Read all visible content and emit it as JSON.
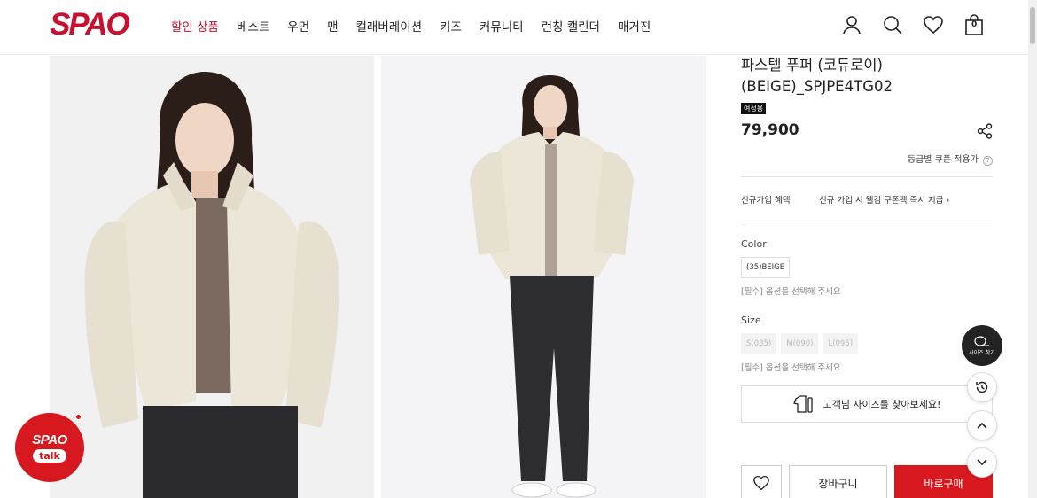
{
  "header": {
    "logo": "SPAO",
    "nav": [
      "할인 상품",
      "베스트",
      "우먼",
      "맨",
      "컬래버레이션",
      "키즈",
      "커뮤니티",
      "런칭 캘린더",
      "매거진"
    ],
    "cart_count": "0"
  },
  "product": {
    "title_line1": "파스텔 푸퍼 (코듀로이)",
    "title_line2": "(BEIGE)_SPJPE4TG02",
    "badge": "여성용",
    "price": "79,900",
    "coupon": "등급별 쿠폰 적용가",
    "coupon_help": "?",
    "benefit_label": "신규가입 혜택",
    "benefit_value": "신규 가입 시 웰컴 쿠폰팩 즉시 지급 ›",
    "color_label": "Color",
    "color_options": [
      "(35)BEIGE"
    ],
    "color_hint": "[필수] 옵션을 선택해 주세요",
    "size_label": "Size",
    "size_options": [
      "S(085)",
      "M(090)",
      "L(095)"
    ],
    "size_hint": "[필수] 옵션을 선택해 주세요",
    "size_finder": "고객님 사이즈를 찾아보세요!",
    "cart_button": "장바구니",
    "buy_button": "바로구매"
  },
  "floating": {
    "size_find": "사이즈 찾기",
    "talk_logo": "SPAO",
    "talk_label": "talk"
  },
  "colors": {
    "brand_red": "#c8102e",
    "buy_red": "#d7191f"
  }
}
